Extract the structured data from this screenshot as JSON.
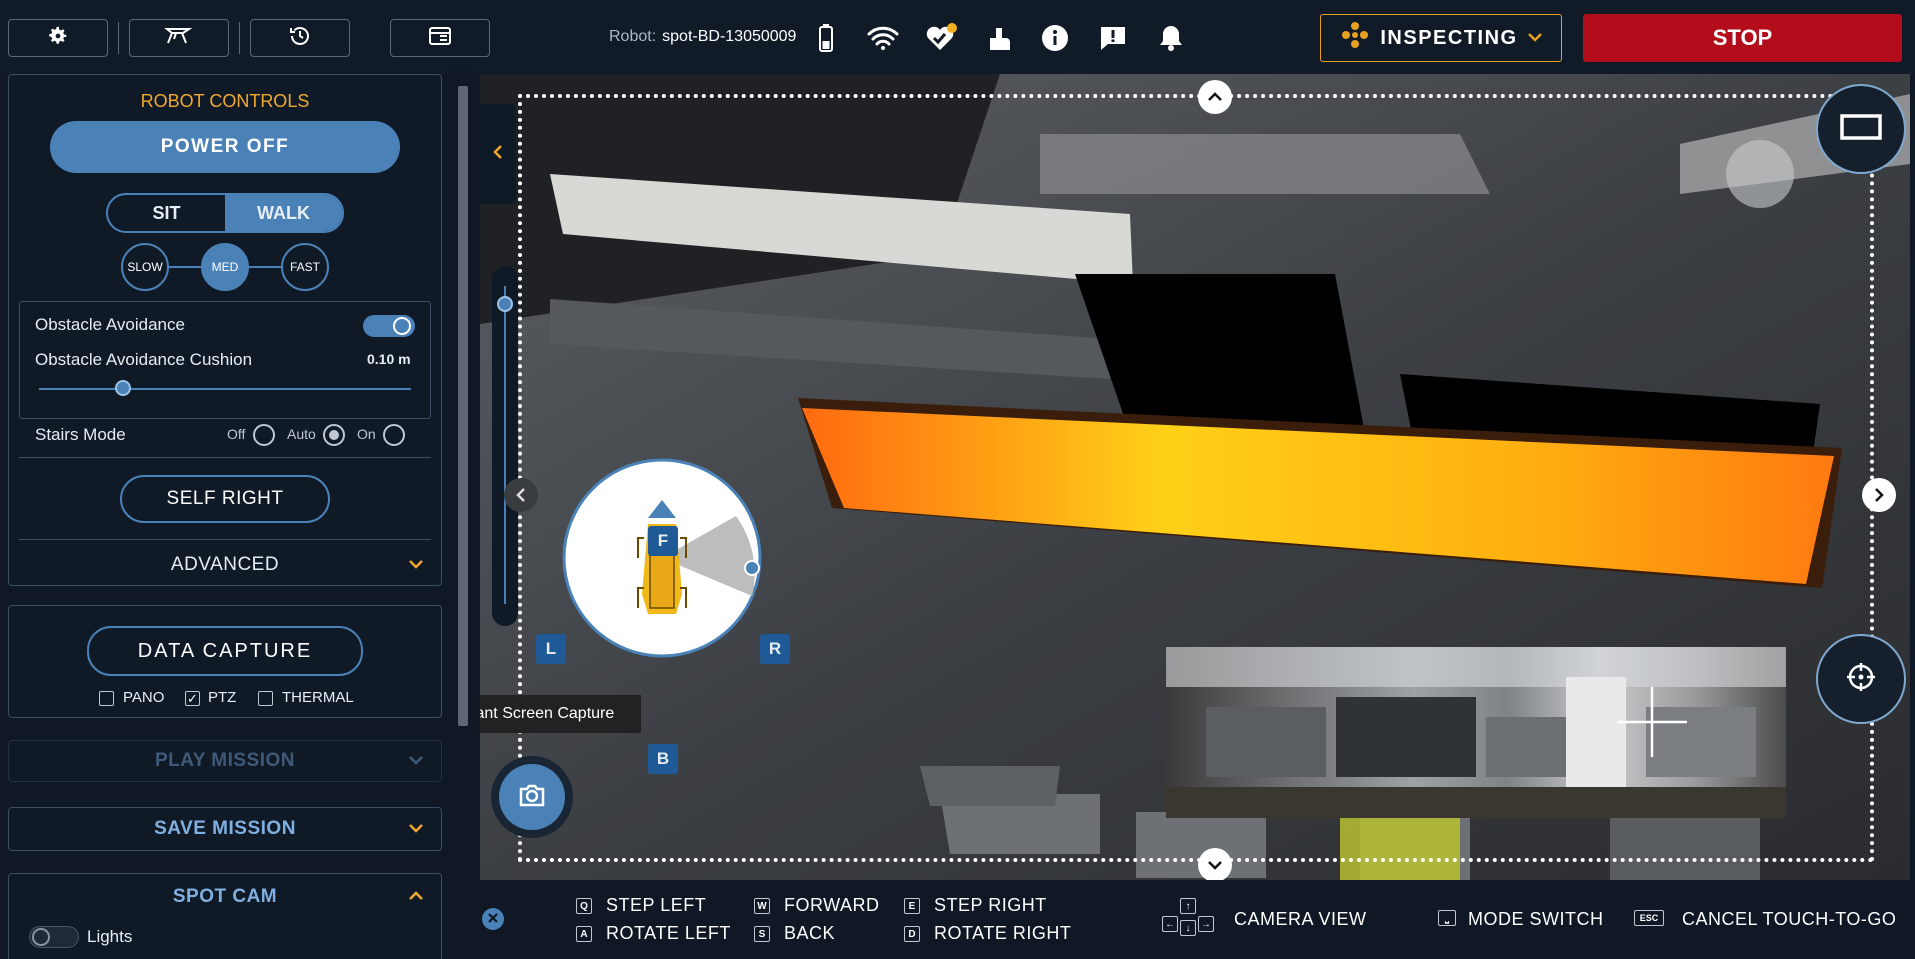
{
  "topbar": {
    "robot_label": "Robot:",
    "robot_name": "spot-BD-13050009",
    "mode_label": "INSPECTING",
    "stop_label": "STOP",
    "colors": {
      "accent": "#e8a020",
      "stop": "#b30d1b",
      "primary": "#4a82b8"
    }
  },
  "robot_controls": {
    "title": "ROBOT CONTROLS",
    "power_label": "POWER OFF",
    "sit_label": "SIT",
    "walk_label": "WALK",
    "speed": [
      "SLOW",
      "MED",
      "FAST"
    ],
    "speed_selected": "MED",
    "obstacle_avoidance_label": "Obstacle Avoidance",
    "obstacle_cushion_label": "Obstacle Avoidance Cushion",
    "obstacle_cushion_value": "0.10 m",
    "stairs_label": "Stairs Mode",
    "stairs_options": [
      "Off",
      "Auto",
      "On"
    ],
    "stairs_selected": "Auto",
    "self_right_label": "SELF RIGHT",
    "advanced_label": "ADVANCED"
  },
  "data_capture": {
    "button_label": "DATA CAPTURE",
    "options": [
      {
        "label": "PANO",
        "checked": false
      },
      {
        "label": "PTZ",
        "checked": true
      },
      {
        "label": "THERMAL",
        "checked": false
      }
    ]
  },
  "sections": {
    "play_mission": "PLAY MISSION",
    "save_mission": "SAVE MISSION",
    "spot_cam": "SPOT CAM",
    "lights": "Lights"
  },
  "camera": {
    "tooltip": "Instant Screen Capture",
    "dir_f": "F",
    "dir_b": "B",
    "dir_l": "L",
    "dir_r": "R"
  },
  "shortcuts": {
    "q": {
      "key": "Q",
      "label": "STEP LEFT"
    },
    "a": {
      "key": "A",
      "label": "ROTATE LEFT"
    },
    "w": {
      "key": "W",
      "label": "FORWARD"
    },
    "s": {
      "key": "S",
      "label": "BACK"
    },
    "e": {
      "key": "E",
      "label": "STEP RIGHT"
    },
    "d": {
      "key": "D",
      "label": "ROTATE RIGHT"
    },
    "camera_view": "CAMERA VIEW",
    "mode_switch": "MODE SWITCH",
    "esc_key": "ESC",
    "cancel": "CANCEL TOUCH-TO-GO"
  }
}
